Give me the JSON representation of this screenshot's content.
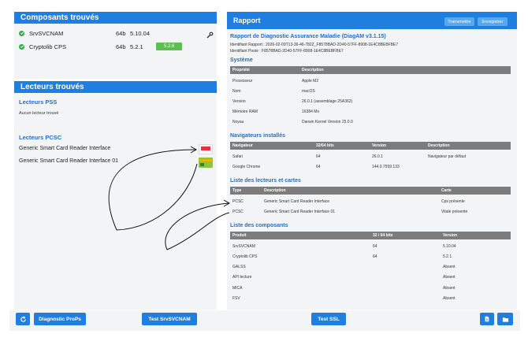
{
  "left": {
    "components_title": "Composants trouvés",
    "components": [
      {
        "name": "SrvSVCNAM",
        "arch": "64b",
        "version": "5.10.04",
        "badge": ""
      },
      {
        "name": "Cryptolib CPS",
        "arch": "64b",
        "version": "5.2.1",
        "badge": "5.2.6"
      }
    ],
    "readers_title": "Lecteurs trouvés",
    "pss_title": "Lecteurs PSS",
    "pss_empty": "Aucun lecteur trouvé",
    "pcsc_title": "Lecteurs PCSC",
    "pcsc_readers": [
      "Generic Smart Card Reader Interface",
      "Generic Smart Card Reader Interface 01"
    ],
    "buttons": {
      "diagnostic": "Diagnostic ProPs",
      "test_srv": "Test SrvSVCNAM"
    }
  },
  "right": {
    "title": "Rapport",
    "btn_transmit": "Transmettre",
    "btn_save": "Enregistrer",
    "report_title": "Rapport de Diagnostic Assurance Maladie (DiagAM v3.1.15)",
    "report_id": "Identifiant Rapport : 2026-02-09T13-36-46-782Z_F8578BAD-2D40-57FF-8908-1E4C8BEBFBE7",
    "station_id": "Identifiant Poste : F8578BAD-2D40-57FF-8908-1E4C8BEBFBE7",
    "system": {
      "title": "Système",
      "headers": [
        "Propriété",
        "Description"
      ],
      "rows": [
        [
          "Processeur",
          "Apple M2"
        ],
        [
          "Nom",
          "macOS"
        ],
        [
          "Version",
          "26.0.1 (assemblage 25A362)"
        ],
        [
          "Mémoire RAM",
          "16384 Mo"
        ],
        [
          "Noyau",
          "Darwin Kernel Version 25.0.0"
        ]
      ]
    },
    "browsers": {
      "title": "Navigateurs installés",
      "headers": [
        "Navigateur",
        "32/64 bits",
        "Version",
        "Description"
      ],
      "rows": [
        [
          "Safari",
          "64",
          "26.0.1",
          "Navigateur par défaut"
        ],
        [
          "Google Chrome",
          "64",
          "144.0.7559.133",
          ""
        ]
      ]
    },
    "readers": {
      "title": "Liste des lecteurs et cartes",
      "headers": [
        "Type",
        "Description",
        "Carte"
      ],
      "rows": [
        [
          "PCSC",
          "Generic Smart Card Reader Interface",
          "Cps présente"
        ],
        [
          "PCSC",
          "Generic Smart Card Reader Interface 01",
          "Vitale présente"
        ]
      ]
    },
    "components": {
      "title": "Liste des composants",
      "headers": [
        "Produit",
        "32 / 64 bits",
        "Version"
      ],
      "rows": [
        [
          "SrvSVCNAM",
          "64",
          "5.10.04"
        ],
        [
          "Cryptolib CPS",
          "64",
          "5.2.1"
        ],
        [
          "GALSS",
          "",
          "Absent"
        ],
        [
          "API lecture",
          "",
          "Absent"
        ],
        [
          "MICA",
          "",
          "Absent"
        ],
        [
          "FSV",
          "",
          "Absent"
        ]
      ]
    },
    "btn_ssl": "Test SSL"
  },
  "colors": {
    "accent": "#1f7fe0",
    "badge": "#5cbf4f",
    "table_header": "#7c7c7c"
  },
  "icons": [
    "check-circle-icon",
    "wrench-icon",
    "refresh-icon",
    "document-icon",
    "folder-icon",
    "cps-card-icon",
    "vitale-card-icon"
  ]
}
